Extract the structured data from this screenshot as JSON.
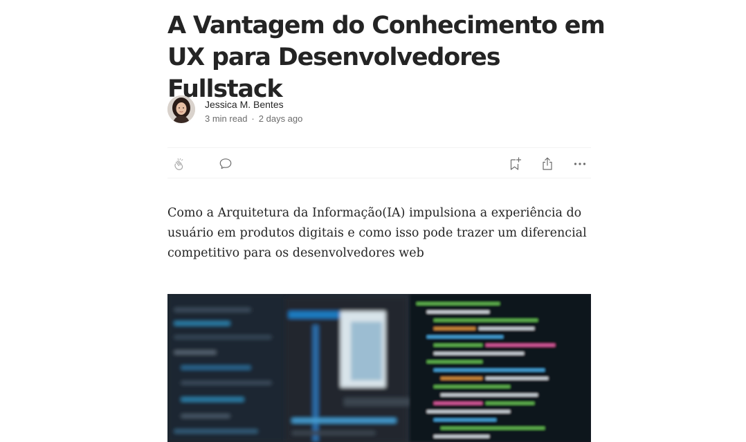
{
  "article": {
    "title": "A Vantagem do Conhecimento em UX para Desenvolvedores Fullstack",
    "subtitle": "Como a Arquitetura da Informação(IA) impulsiona a experiência do usuário em produtos digitais e como isso pode trazer um diferencial competitivo para os desenvolvedores web",
    "hero_image_alt": "",
    "icons": {
      "clap": "clap-icon",
      "comment": "comment-icon",
      "bookmark": "bookmark-add-icon",
      "share": "share-icon",
      "more": "more-horizontal-icon"
    }
  },
  "author": {
    "name": "Jessica M. Bentes",
    "read_time": "3 min read",
    "separator": "·",
    "published": "2 days ago"
  },
  "colors": {
    "text": "#242424",
    "meta": "#6b6b6b",
    "icon": "#6b6b6b",
    "divider": "#f2f2f2",
    "clap_inactive": "#a8a8a8"
  }
}
